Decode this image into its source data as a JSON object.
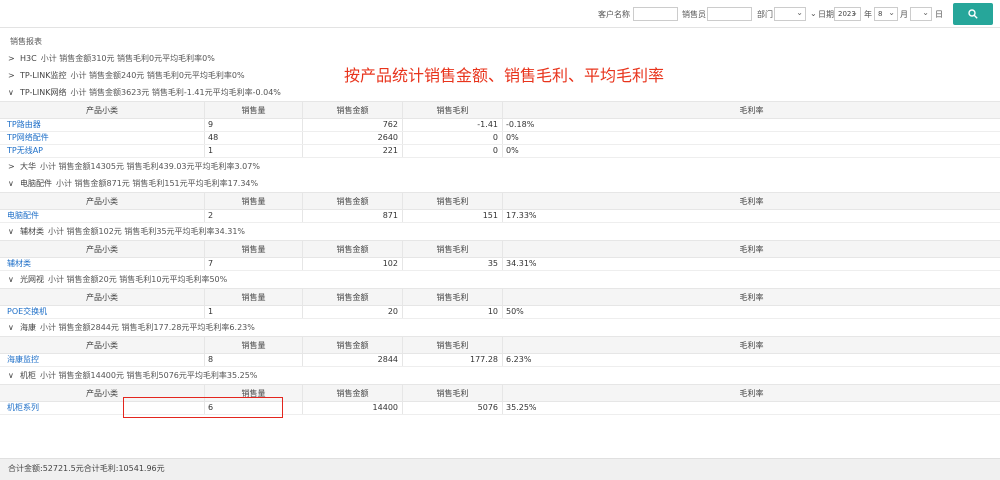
{
  "toolbar": {
    "customer_label": "客户名称",
    "salesperson_label": "销售员",
    "dept_label": "部门",
    "date_label": "日期",
    "year_value": "2023",
    "year_unit": "年",
    "month_value": "8",
    "month_unit": "月",
    "day_unit": "日"
  },
  "report_title": "销售报表",
  "annotation": "按产品统计销售金额、销售毛利、平均毛利率",
  "columns": [
    "产品小类",
    "销售量",
    "销售金额",
    "销售毛利",
    "毛利率"
  ],
  "groups": [
    {
      "chev": ">",
      "name": "H3C",
      "summary": "小计 销售金额310元 销售毛利0元平均毛利率0%",
      "rows": []
    },
    {
      "chev": ">",
      "name": "TP-LINK监控",
      "summary": "小计 销售金额240元 销售毛利0元平均毛利率0%",
      "rows": []
    },
    {
      "chev": "∨",
      "name": "TP-LINK网络",
      "summary": "小计 销售金额3623元 销售毛利-1.41元平均毛利率-0.04%",
      "rows": [
        {
          "name": "TP路由器",
          "qty": "9",
          "amount": "762",
          "profit": "-1.41",
          "rate": "-0.18%"
        },
        {
          "name": "TP网络配件",
          "qty": "48",
          "amount": "2640",
          "profit": "0",
          "rate": "0%"
        },
        {
          "name": "TP无线AP",
          "qty": "1",
          "amount": "221",
          "profit": "0",
          "rate": "0%"
        }
      ]
    },
    {
      "chev": ">",
      "name": "大华",
      "summary": "小计 销售金额14305元 销售毛利439.03元平均毛利率3.07%",
      "rows": []
    },
    {
      "chev": "∨",
      "name": "电脑配件",
      "summary": "小计 销售金额871元 销售毛利151元平均毛利率17.34%",
      "rows": [
        {
          "name": "电脑配件",
          "qty": "2",
          "amount": "871",
          "profit": "151",
          "rate": "17.33%"
        }
      ]
    },
    {
      "chev": "∨",
      "name": "辅材类",
      "summary": "小计 销售金额102元 销售毛利35元平均毛利率34.31%",
      "rows": [
        {
          "name": "辅材类",
          "qty": "7",
          "amount": "102",
          "profit": "35",
          "rate": "34.31%"
        }
      ]
    },
    {
      "chev": "∨",
      "name": "光网视",
      "summary": "小计 销售金额20元 销售毛利10元平均毛利率50%",
      "rows": [
        {
          "name": "POE交换机",
          "qty": "1",
          "amount": "20",
          "profit": "10",
          "rate": "50%"
        }
      ]
    },
    {
      "chev": "∨",
      "name": "海康",
      "summary": "小计 销售金额2844元 销售毛利177.28元平均毛利率6.23%",
      "rows": [
        {
          "name": "海康监控",
          "qty": "8",
          "amount": "2844",
          "profit": "177.28",
          "rate": "6.23%"
        }
      ]
    },
    {
      "chev": "∨",
      "name": "机柜",
      "summary": "小计 销售金额14400元 销售毛利5076元平均毛利率35.25%",
      "rows": [
        {
          "name": "机柜系列",
          "qty": "6",
          "amount": "14400",
          "profit": "5076",
          "rate": "35.25%"
        }
      ]
    }
  ],
  "footer": "合计金额:52721.5元合计毛利:10541.96元",
  "colors": {
    "accent": "#26a69a",
    "link": "#1e6fc8",
    "annotation": "#e8341c"
  }
}
